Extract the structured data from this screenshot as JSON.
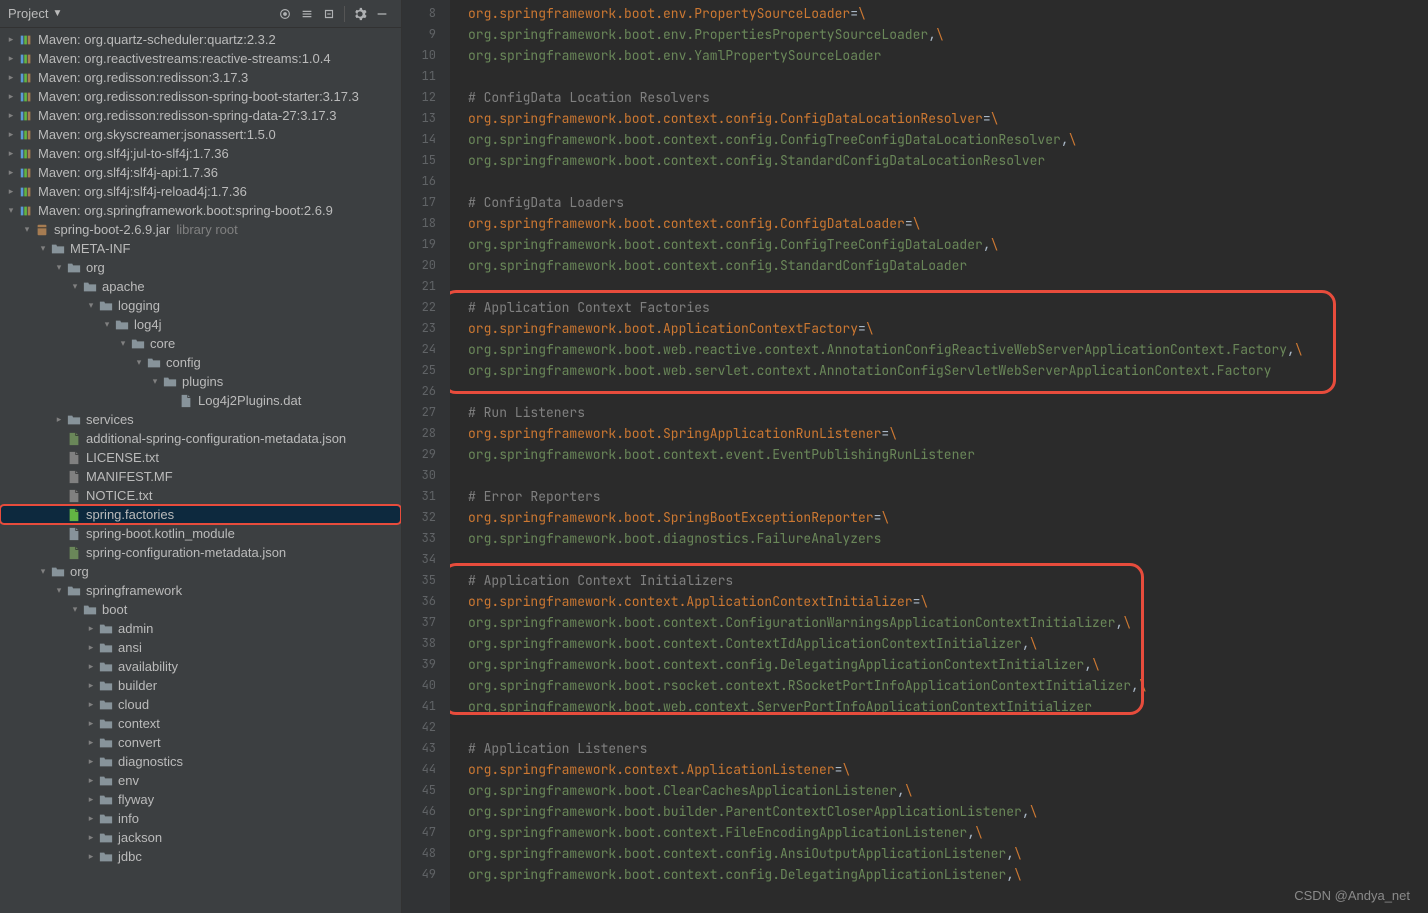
{
  "sidebar": {
    "title": "Project",
    "tree": [
      {
        "depth": 0,
        "chev": ">",
        "icon": "lib",
        "label": "Maven: org.quartz-scheduler:quartz:2.3.2"
      },
      {
        "depth": 0,
        "chev": ">",
        "icon": "lib",
        "label": "Maven: org.reactivestreams:reactive-streams:1.0.4"
      },
      {
        "depth": 0,
        "chev": ">",
        "icon": "lib",
        "label": "Maven: org.redisson:redisson:3.17.3"
      },
      {
        "depth": 0,
        "chev": ">",
        "icon": "lib",
        "label": "Maven: org.redisson:redisson-spring-boot-starter:3.17.3"
      },
      {
        "depth": 0,
        "chev": ">",
        "icon": "lib",
        "label": "Maven: org.redisson:redisson-spring-data-27:3.17.3"
      },
      {
        "depth": 0,
        "chev": ">",
        "icon": "lib",
        "label": "Maven: org.skyscreamer:jsonassert:1.5.0"
      },
      {
        "depth": 0,
        "chev": ">",
        "icon": "lib",
        "label": "Maven: org.slf4j:jul-to-slf4j:1.7.36"
      },
      {
        "depth": 0,
        "chev": ">",
        "icon": "lib",
        "label": "Maven: org.slf4j:slf4j-api:1.7.36"
      },
      {
        "depth": 0,
        "chev": ">",
        "icon": "lib",
        "label": "Maven: org.slf4j:slf4j-reload4j:1.7.36"
      },
      {
        "depth": 0,
        "chev": "v",
        "icon": "lib",
        "label": "Maven: org.springframework.boot:spring-boot:2.6.9"
      },
      {
        "depth": 1,
        "chev": "v",
        "icon": "jar",
        "label": "spring-boot-2.6.9.jar",
        "sub": "library root"
      },
      {
        "depth": 2,
        "chev": "v",
        "icon": "folder",
        "label": "META-INF"
      },
      {
        "depth": 3,
        "chev": "v",
        "icon": "folder",
        "label": "org"
      },
      {
        "depth": 4,
        "chev": "v",
        "icon": "folder",
        "label": "apache"
      },
      {
        "depth": 5,
        "chev": "v",
        "icon": "folder",
        "label": "logging"
      },
      {
        "depth": 6,
        "chev": "v",
        "icon": "folder",
        "label": "log4j"
      },
      {
        "depth": 7,
        "chev": "v",
        "icon": "folder",
        "label": "core"
      },
      {
        "depth": 8,
        "chev": "v",
        "icon": "folder",
        "label": "config"
      },
      {
        "depth": 9,
        "chev": "v",
        "icon": "folder",
        "label": "plugins"
      },
      {
        "depth": 10,
        "chev": "",
        "icon": "file",
        "label": "Log4j2Plugins.dat"
      },
      {
        "depth": 3,
        "chev": ">",
        "icon": "folder",
        "label": "services"
      },
      {
        "depth": 3,
        "chev": "",
        "icon": "json",
        "label": "additional-spring-configuration-metadata.json"
      },
      {
        "depth": 3,
        "chev": "",
        "icon": "txt",
        "label": "LICENSE.txt"
      },
      {
        "depth": 3,
        "chev": "",
        "icon": "mf",
        "label": "MANIFEST.MF"
      },
      {
        "depth": 3,
        "chev": "",
        "icon": "txt",
        "label": "NOTICE.txt"
      },
      {
        "depth": 3,
        "chev": "",
        "icon": "prop",
        "label": "spring.factories",
        "hi": true
      },
      {
        "depth": 3,
        "chev": "",
        "icon": "file",
        "label": "spring-boot.kotlin_module"
      },
      {
        "depth": 3,
        "chev": "",
        "icon": "json",
        "label": "spring-configuration-metadata.json"
      },
      {
        "depth": 2,
        "chev": "v",
        "icon": "folder",
        "label": "org"
      },
      {
        "depth": 3,
        "chev": "v",
        "icon": "folder",
        "label": "springframework"
      },
      {
        "depth": 4,
        "chev": "v",
        "icon": "folder",
        "label": "boot"
      },
      {
        "depth": 5,
        "chev": ">",
        "icon": "folder",
        "label": "admin"
      },
      {
        "depth": 5,
        "chev": ">",
        "icon": "folder",
        "label": "ansi"
      },
      {
        "depth": 5,
        "chev": ">",
        "icon": "folder",
        "label": "availability"
      },
      {
        "depth": 5,
        "chev": ">",
        "icon": "folder",
        "label": "builder"
      },
      {
        "depth": 5,
        "chev": ">",
        "icon": "folder",
        "label": "cloud"
      },
      {
        "depth": 5,
        "chev": ">",
        "icon": "folder",
        "label": "context"
      },
      {
        "depth": 5,
        "chev": ">",
        "icon": "folder",
        "label": "convert"
      },
      {
        "depth": 5,
        "chev": ">",
        "icon": "folder",
        "label": "diagnostics"
      },
      {
        "depth": 5,
        "chev": ">",
        "icon": "folder",
        "label": "env"
      },
      {
        "depth": 5,
        "chev": ">",
        "icon": "folder",
        "label": "flyway"
      },
      {
        "depth": 5,
        "chev": ">",
        "icon": "folder",
        "label": "info"
      },
      {
        "depth": 5,
        "chev": ">",
        "icon": "folder",
        "label": "jackson"
      },
      {
        "depth": 5,
        "chev": ">",
        "icon": "folder",
        "label": "jdbc"
      }
    ]
  },
  "code": {
    "start": 8,
    "lines": [
      {
        "t": "kv",
        "k": "org.springframework.boot.env.PropertySourceLoader",
        "eq": "=",
        "c": "\\"
      },
      {
        "t": "vc",
        "v": "org.springframework.boot.env.PropertiesPropertySourceLoader",
        "comma": ",",
        "c": "\\"
      },
      {
        "t": "v",
        "v": "org.springframework.boot.env.YamlPropertySourceLoader"
      },
      {
        "t": "blank"
      },
      {
        "t": "c",
        "text": "# ConfigData Location Resolvers"
      },
      {
        "t": "kv",
        "k": "org.springframework.boot.context.config.ConfigDataLocationResolver",
        "eq": "=",
        "c": "\\"
      },
      {
        "t": "vc",
        "v": "org.springframework.boot.context.config.ConfigTreeConfigDataLocationResolver",
        "comma": ",",
        "c": "\\"
      },
      {
        "t": "v",
        "v": "org.springframework.boot.context.config.StandardConfigDataLocationResolver"
      },
      {
        "t": "blank"
      },
      {
        "t": "c",
        "text": "# ConfigData Loaders"
      },
      {
        "t": "kv",
        "k": "org.springframework.boot.context.config.ConfigDataLoader",
        "eq": "=",
        "c": "\\"
      },
      {
        "t": "vc",
        "v": "org.springframework.boot.context.config.ConfigTreeConfigDataLoader",
        "comma": ",",
        "c": "\\"
      },
      {
        "t": "v",
        "v": "org.springframework.boot.context.config.StandardConfigDataLoader"
      },
      {
        "t": "blank"
      },
      {
        "t": "c",
        "text": "# Application Context Factories"
      },
      {
        "t": "kv",
        "k": "org.springframework.boot.ApplicationContextFactory",
        "eq": "=",
        "c": "\\"
      },
      {
        "t": "vc",
        "v": "org.springframework.boot.web.reactive.context.AnnotationConfigReactiveWebServerApplicationContext.Factory",
        "comma": ",",
        "c": "\\"
      },
      {
        "t": "v",
        "v": "org.springframework.boot.web.servlet.context.AnnotationConfigServletWebServerApplicationContext.Factory"
      },
      {
        "t": "blank"
      },
      {
        "t": "c",
        "text": "# Run Listeners"
      },
      {
        "t": "kv",
        "k": "org.springframework.boot.SpringApplicationRunListener",
        "eq": "=",
        "c": "\\"
      },
      {
        "t": "v",
        "v": "org.springframework.boot.context.event.EventPublishingRunListener"
      },
      {
        "t": "blank"
      },
      {
        "t": "c",
        "text": "# Error Reporters"
      },
      {
        "t": "kv",
        "k": "org.springframework.boot.SpringBootExceptionReporter",
        "eq": "=",
        "c": "\\"
      },
      {
        "t": "v",
        "v": "org.springframework.boot.diagnostics.FailureAnalyzers"
      },
      {
        "t": "blank"
      },
      {
        "t": "c",
        "text": "# Application Context Initializers"
      },
      {
        "t": "kv",
        "k": "org.springframework.context.ApplicationContextInitializer",
        "eq": "=",
        "c": "\\"
      },
      {
        "t": "vc",
        "v": "org.springframework.boot.context.ConfigurationWarningsApplicationContextInitializer",
        "comma": ",",
        "c": "\\"
      },
      {
        "t": "vc",
        "v": "org.springframework.boot.context.ContextIdApplicationContextInitializer",
        "comma": ",",
        "c": "\\"
      },
      {
        "t": "vc",
        "v": "org.springframework.boot.context.config.DelegatingApplicationContextInitializer",
        "comma": ",",
        "c": "\\"
      },
      {
        "t": "vc",
        "v": "org.springframework.boot.rsocket.context.RSocketPortInfoApplicationContextInitializer",
        "comma": ",",
        "c": "\\"
      },
      {
        "t": "v",
        "v": "org.springframework.boot.web.context.ServerPortInfoApplicationContextInitializer"
      },
      {
        "t": "blank"
      },
      {
        "t": "c",
        "text": "# Application Listeners"
      },
      {
        "t": "kv",
        "k": "org.springframework.context.ApplicationListener",
        "eq": "=",
        "c": "\\"
      },
      {
        "t": "vc",
        "v": "org.springframework.boot.ClearCachesApplicationListener",
        "comma": ",",
        "c": "\\"
      },
      {
        "t": "vc",
        "v": "org.springframework.boot.builder.ParentContextCloserApplicationListener",
        "comma": ",",
        "c": "\\"
      },
      {
        "t": "vc",
        "v": "org.springframework.boot.context.FileEncodingApplicationListener",
        "comma": ",",
        "c": "\\"
      },
      {
        "t": "vc",
        "v": "org.springframework.boot.context.config.AnsiOutputApplicationListener",
        "comma": ",",
        "c": "\\"
      },
      {
        "t": "vc",
        "v": "org.springframework.boot.context.config.DelegatingApplicationListener",
        "comma": ",",
        "c": "\\"
      }
    ]
  },
  "watermark": "CSDN @Andya_net"
}
